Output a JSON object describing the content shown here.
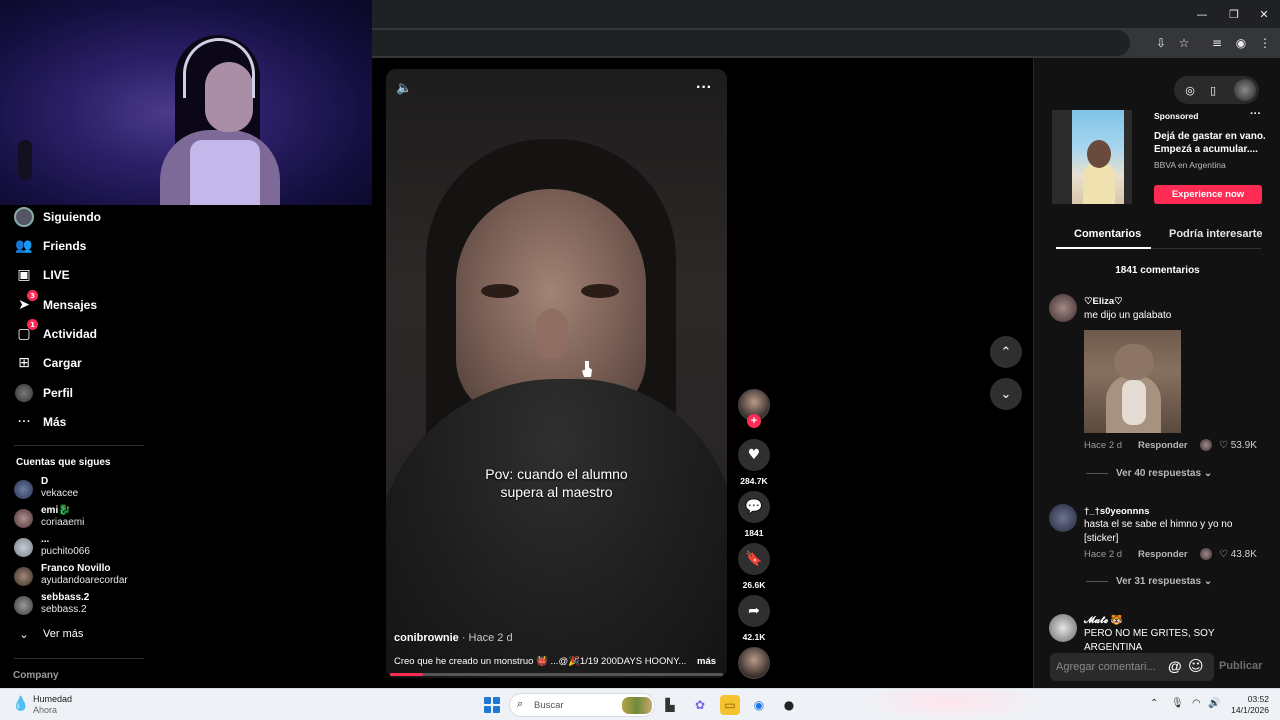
{
  "nav": {
    "items": [
      {
        "label": "Siguiendo",
        "icon": "following-avatar-icon"
      },
      {
        "label": "Friends",
        "icon": "friends-icon"
      },
      {
        "label": "LIVE",
        "icon": "live-icon"
      },
      {
        "label": "Mensajes",
        "icon": "messages-icon",
        "badge": "3"
      },
      {
        "label": "Actividad",
        "icon": "activity-icon",
        "badge": "1"
      },
      {
        "label": "Cargar",
        "icon": "upload-icon"
      },
      {
        "label": "Perfil",
        "icon": "profile-avatar-icon"
      },
      {
        "label": "Más",
        "icon": "more-icon"
      }
    ],
    "following_title": "Cuentas que sigues",
    "following": [
      {
        "name": "D",
        "user": "vekacee"
      },
      {
        "name": "emi🐉",
        "user": "coriaaemi"
      },
      {
        "name": "...",
        "user": "puchito066"
      },
      {
        "name": "Franco Novillo",
        "user": "ayudandoarecordar"
      },
      {
        "name": "sebbass.2",
        "user": "sebbass.2"
      }
    ],
    "see_more": "Ver más",
    "company": "Company"
  },
  "video": {
    "caption_line1": "Pov: cuando el alumno",
    "caption_line2": "supera al maestro",
    "author": "conibrownie",
    "posted": " · Hace 2 d",
    "description": "Creo que he creado un monstruo 👹 ...@🎉1/19 200DAYS HOONY...",
    "more": "más",
    "progress": 0.1
  },
  "actions": {
    "likes": "284.7K",
    "comments": "1841",
    "saves": "26.6K",
    "shares": "42.1K"
  },
  "ad": {
    "sponsored": "Sponsored",
    "title": "Dejá de gastar en vano. Empezá a acumular....",
    "source": "BBVA en Argentina",
    "cta": "Experience now"
  },
  "tabs": {
    "comments": "Comentarios",
    "suggested": "Podría interesarte"
  },
  "comments_count": "1841 comentarios",
  "comments": [
    {
      "name": "♡Eliza♡",
      "text": "me dijo un galabato",
      "time": "Hace 2 d",
      "reply": "Responder",
      "likes": "53.9K",
      "replies": "Ver 40 respuestas ⌄"
    },
    {
      "name": "†_†s0yeonnns",
      "text": "hasta el se sabe el himno y yo no [sticker]",
      "time": "Hace 2 d",
      "reply": "Responder",
      "likes": "43.8K",
      "replies": "Ver 31 respuestas ⌄"
    },
    {
      "name": "𝓜𝓪𝓽𝓮 🐯",
      "text": "PERO NO ME GRITES, SOY ARGENTINA"
    }
  ],
  "comment_input": {
    "placeholder": "Agregar comentari...",
    "publish": "Publicar"
  },
  "taskbar": {
    "weather_title": "Humedad",
    "weather_sub": "Ahora",
    "search": "Buscar",
    "time": "03:52",
    "date": "14/1/2026"
  },
  "colors": {
    "accent": "#fe2c55",
    "background": "#000000",
    "panel": "#121212"
  }
}
